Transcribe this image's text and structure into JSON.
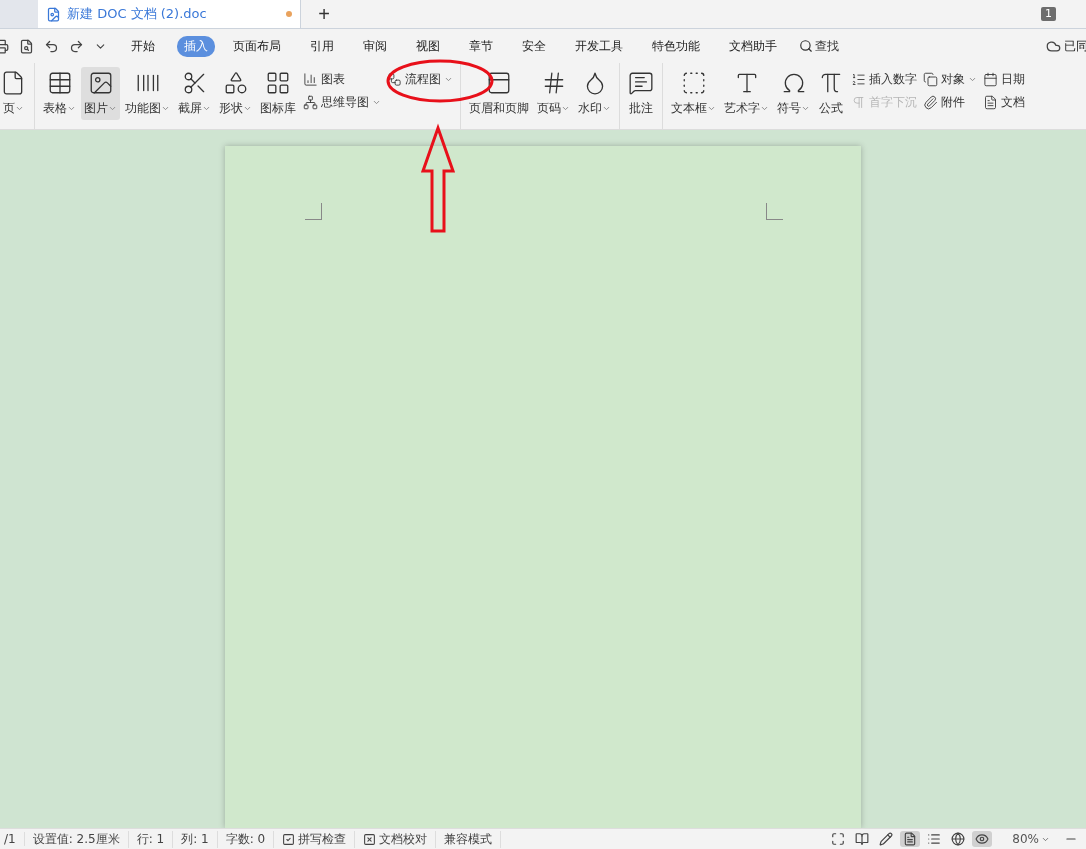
{
  "doc_tab": {
    "title": "新建 DOC 文档 (2).doc",
    "modified": true,
    "new_tab": "+",
    "page_count": "1"
  },
  "menu": {
    "tabs": [
      {
        "label": "开始",
        "selected": false
      },
      {
        "label": "插入",
        "selected": true
      },
      {
        "label": "页面布局",
        "selected": false
      },
      {
        "label": "引用",
        "selected": false
      },
      {
        "label": "审阅",
        "selected": false
      },
      {
        "label": "视图",
        "selected": false
      },
      {
        "label": "章节",
        "selected": false
      },
      {
        "label": "安全",
        "selected": false
      },
      {
        "label": "开发工具",
        "selected": false
      },
      {
        "label": "特色功能",
        "selected": false
      },
      {
        "label": "文档助手",
        "selected": false
      }
    ],
    "search": "查找",
    "sync": "已同"
  },
  "ribbon": {
    "groups": [
      {
        "items": [
          {
            "kind": "large",
            "label": "页",
            "caret": true,
            "selected": false
          }
        ]
      },
      {
        "items": [
          {
            "kind": "large",
            "label": "表格",
            "caret": true,
            "selected": false
          },
          {
            "kind": "large",
            "label": "图片",
            "caret": true,
            "selected": true
          },
          {
            "kind": "large",
            "label": "功能图",
            "caret": true,
            "selected": false
          },
          {
            "kind": "large",
            "label": "截屏",
            "caret": true,
            "selected": false
          },
          {
            "kind": "large",
            "label": "形状",
            "caret": true,
            "selected": false
          },
          {
            "kind": "large",
            "label": "图标库",
            "caret": false,
            "selected": false
          },
          {
            "kind": "stack",
            "entries": [
              {
                "label": "图表",
                "caret": false,
                "disabled": false
              },
              {
                "label": "思维导图",
                "caret": true,
                "disabled": false
              }
            ]
          },
          {
            "kind": "stack",
            "entries": [
              {
                "label": "流程图",
                "caret": true,
                "disabled": false
              }
            ]
          }
        ]
      },
      {
        "items": [
          {
            "kind": "large",
            "label": "页眉和页脚",
            "caret": false,
            "selected": false
          },
          {
            "kind": "large",
            "label": "页码",
            "caret": true,
            "selected": false
          },
          {
            "kind": "large",
            "label": "水印",
            "caret": true,
            "selected": false
          }
        ]
      },
      {
        "items": [
          {
            "kind": "large",
            "label": "批注",
            "caret": false,
            "selected": false
          }
        ]
      },
      {
        "items": [
          {
            "kind": "large",
            "label": "文本框",
            "caret": true,
            "selected": false
          },
          {
            "kind": "large",
            "label": "艺术字",
            "caret": true,
            "selected": false
          },
          {
            "kind": "large",
            "label": "符号",
            "caret": true,
            "selected": false
          },
          {
            "kind": "large",
            "label": "公式",
            "caret": false,
            "selected": false
          },
          {
            "kind": "stack",
            "entries": [
              {
                "label": "插入数字",
                "caret": false,
                "disabled": false
              },
              {
                "label": "首字下沉",
                "caret": false,
                "disabled": true
              }
            ]
          },
          {
            "kind": "stack",
            "entries": [
              {
                "label": "对象",
                "caret": true,
                "disabled": false
              },
              {
                "label": "附件",
                "caret": false,
                "disabled": false
              }
            ]
          },
          {
            "kind": "stack",
            "entries": [
              {
                "label": "日期",
                "caret": false,
                "disabled": false
              },
              {
                "label": "文档",
                "caret": false,
                "disabled": false
              }
            ]
          }
        ]
      }
    ]
  },
  "status_bar": {
    "items": [
      "/1",
      "设置值: 2.5厘米",
      "行: 1",
      "列: 1",
      "字数: 0"
    ],
    "spell_check": "拼写检查",
    "proofread": "文档校对",
    "compat": "兼容模式",
    "views": [
      {
        "selected": false
      },
      {
        "selected": false
      },
      {
        "selected": false
      },
      {
        "selected": true
      },
      {
        "selected": false
      },
      {
        "selected": false
      },
      {
        "selected": true
      }
    ],
    "zoom": "80%"
  }
}
